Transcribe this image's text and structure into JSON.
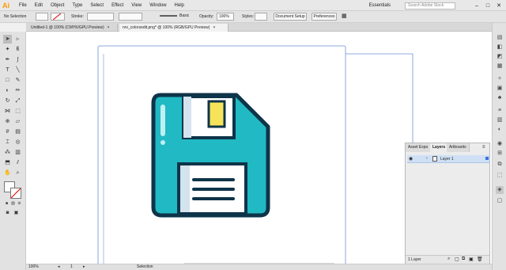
{
  "menubar": {
    "logo": "Ai",
    "menus": [
      "File",
      "Edit",
      "Object",
      "Type",
      "Select",
      "Effect",
      "View",
      "Window",
      "Help"
    ],
    "workspace": "Essentials",
    "search_placeholder": "Search Adobe Stock",
    "window_controls": [
      "–",
      "□",
      "✕"
    ]
  },
  "controlbar": {
    "selection_label": "No Selection",
    "stroke_label": "Stroke:",
    "brush_label": "Basic",
    "opacity_label": "Opacity:",
    "opacity_value": "100%",
    "styles_label": "Styles:",
    "document_setup": "Document Setup",
    "preferences": "Preferences"
  },
  "tabs": [
    {
      "label": "Untitled-1 @ 100% (CMYK/GPU Preview)",
      "close": "×"
    },
    {
      "label": "nrv_colorsedit.png* @ 100% (RGB/GPU Preview)",
      "close": "×"
    }
  ],
  "toolbar": {
    "icons": [
      "selection-tool-icon",
      "direct-selection-tool-icon",
      "magic-wand-icon",
      "lasso-icon",
      "pen-icon",
      "curvature-icon",
      "type-icon",
      "line-icon",
      "rectangle-icon",
      "paintbrush-icon",
      "shaper-icon",
      "pencil-icon",
      "eraser-icon",
      "rotate-icon",
      "scale-icon",
      "width-icon",
      "free-transform-icon",
      "shape-builder-icon",
      "perspective-icon",
      "mesh-icon",
      "gradient-icon",
      "eyedropper-icon",
      "blend-icon",
      "symbol-sprayer-icon",
      "graph-icon",
      "artboard-icon",
      "slice-icon",
      "hand-icon",
      "zoom-icon"
    ]
  },
  "panel": {
    "tabs": [
      "Asset Expo",
      "Layers",
      "Artboards"
    ],
    "menu_glyph": "≡",
    "layer_name": "Layer 1",
    "layer_count": "1 Layer"
  },
  "statusbar": {
    "zoom": "100%",
    "artboard": "1",
    "tool": "Selection"
  },
  "colors": {
    "disk_teal": "#21b9c4",
    "disk_outline": "#0e3449",
    "label_yellow": "#f7e35a",
    "artboard_guide": "#6b8fd6"
  }
}
